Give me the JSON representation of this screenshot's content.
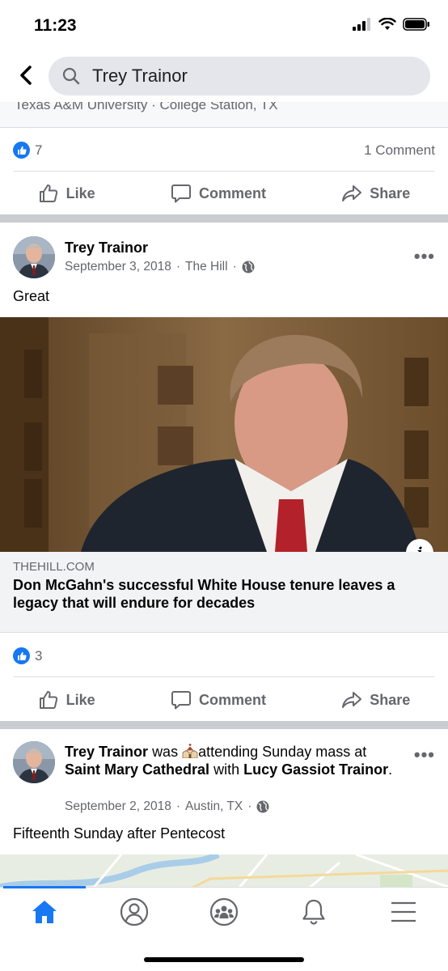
{
  "status_bar": {
    "time": "11:23"
  },
  "search": {
    "query": "Trey Trainor"
  },
  "previous_post": {
    "location": "Texas A&M University · College Station, TX",
    "like_count": "7",
    "comment_count": "1 Comment"
  },
  "actions": {
    "like": "Like",
    "comment": "Comment",
    "share": "Share"
  },
  "post1": {
    "author": "Trey Trainor",
    "date": "September 3, 2018",
    "via": "The Hill",
    "text": "Great",
    "link_domain": "THEHILL.COM",
    "link_title": "Don McGahn's successful White House tenure leaves a legacy that will endure for decades",
    "info_glyph": "i",
    "like_count": "3"
  },
  "post2": {
    "author": "Trey Trainor",
    "was": "was",
    "activity": "attending Sunday mass at",
    "place": "Saint Mary Cathedral",
    "with": "with",
    "companion": "Lucy Gassiot Trainor",
    "period": ".",
    "date": "September 2, 2018",
    "location": "Austin, TX",
    "text": "Fifteenth Sunday after Pentecost"
  },
  "tabs": {
    "active": "home",
    "items": [
      "home-icon",
      "profile-icon",
      "groups-icon",
      "notifications-icon",
      "menu-icon"
    ]
  },
  "colors": {
    "accent": "#1877f2",
    "secondary_text": "#65676b",
    "separator": "#c9ccd1"
  }
}
